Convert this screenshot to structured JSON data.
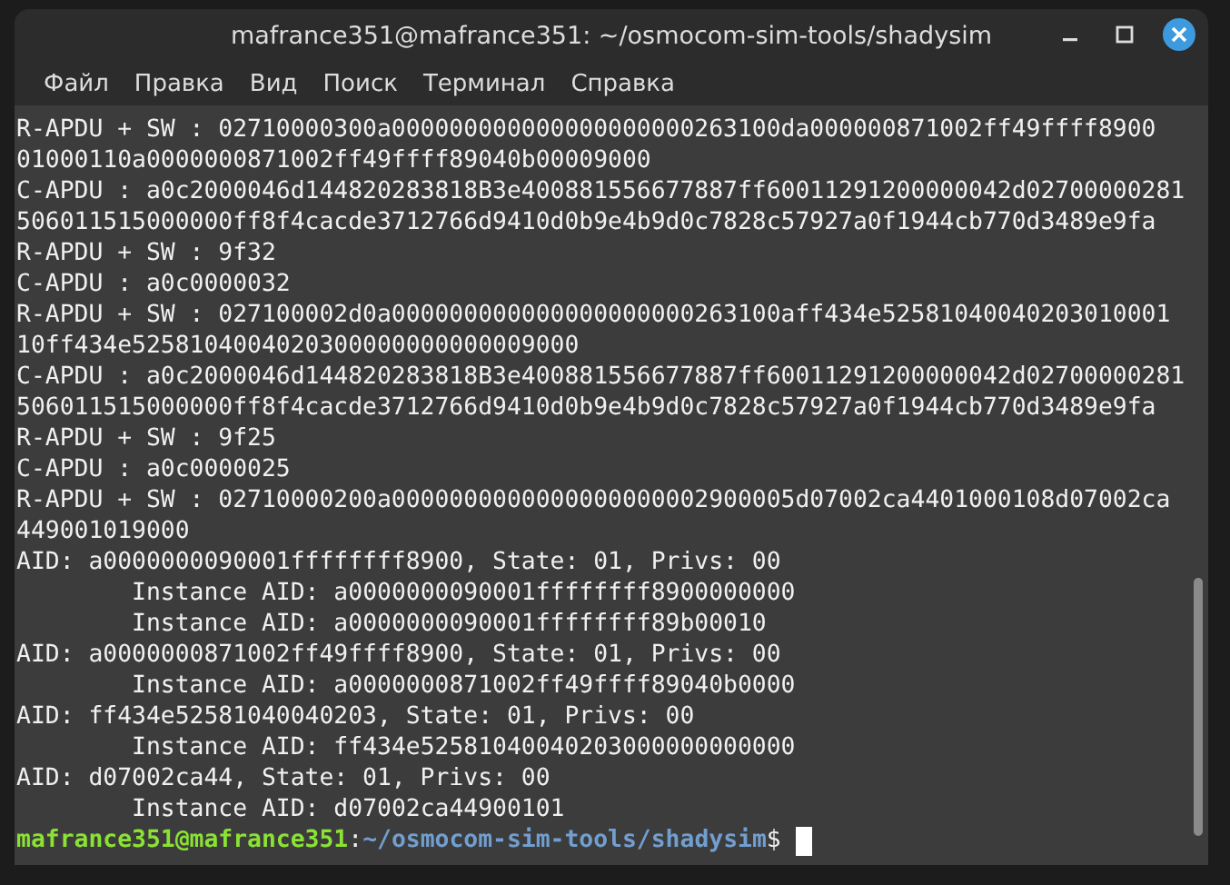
{
  "window": {
    "title": "mafrance351@mafrance351: ~/osmocom-sim-tools/shadysim"
  },
  "menu": [
    "Файл",
    "Правка",
    "Вид",
    "Поиск",
    "Терминал",
    "Справка"
  ],
  "terminal": {
    "lines": [
      {
        "kind": "output",
        "text": "R-APDU + SW : 02710000300a000000000000000000000263100da000000871002ff49ffff8900"
      },
      {
        "kind": "output",
        "text": "01000110a0000000871002ff49ffff89040b00009000"
      },
      {
        "kind": "output",
        "text": "C-APDU : a0c2000046d144820283818B3e400881556677887ff60011291200000042d02700000281"
      },
      {
        "kind": "output",
        "text": "506011515000000ff8f4cacde3712766d9410d0b9e4b9d0c7828c57927a0f1944cb770d3489e9fa"
      },
      {
        "kind": "output",
        "text": "R-APDU + SW : 9f32"
      },
      {
        "kind": "output",
        "text": "C-APDU : a0c0000032"
      },
      {
        "kind": "output",
        "text": "R-APDU + SW : 027100002d0a000000000000000000000263100aff434e52581040040203010001"
      },
      {
        "kind": "output",
        "text": "10ff434e5258104004020300000000000009000"
      },
      {
        "kind": "output",
        "text": "C-APDU : a0c2000046d144820283818B3e400881556677887ff60011291200000042d02700000281"
      },
      {
        "kind": "output",
        "text": "506011515000000ff8f4cacde3712766d9410d0b9e4b9d0c7828c57927a0f1944cb770d3489e9fa"
      },
      {
        "kind": "output",
        "text": "R-APDU + SW : 9f25"
      },
      {
        "kind": "output",
        "text": "C-APDU : a0c0000025"
      },
      {
        "kind": "output",
        "text": "R-APDU + SW : 02710000200a0000000000000000000002900005d07002ca4401000108d07002ca"
      },
      {
        "kind": "output",
        "text": "449001019000"
      },
      {
        "kind": "output",
        "text": "AID: a0000000090001ffffffff8900, State: 01, Privs: 00"
      },
      {
        "kind": "output",
        "text": "\tInstance AID: a0000000090001ffffffff8900000000"
      },
      {
        "kind": "output",
        "text": "\tInstance AID: a0000000090001ffffffff89b00010"
      },
      {
        "kind": "output",
        "text": "AID: a0000000871002ff49ffff8900, State: 01, Privs: 00"
      },
      {
        "kind": "output",
        "text": "\tInstance AID: a0000000871002ff49ffff89040b0000"
      },
      {
        "kind": "output",
        "text": "AID: ff434e52581040040203, State: 01, Privs: 00"
      },
      {
        "kind": "output",
        "text": "\tInstance AID: ff434e52581040040203000000000000"
      },
      {
        "kind": "output",
        "text": "AID: d07002ca44, State: 01, Privs: 00"
      },
      {
        "kind": "output",
        "text": "\tInstance AID: d07002ca44900101"
      },
      {
        "kind": "prompt",
        "user_host": "mafrance351@mafrance351",
        "separator": ":",
        "path": "~/osmocom-sim-tools/shadysim",
        "symbol": "$"
      }
    ]
  }
}
